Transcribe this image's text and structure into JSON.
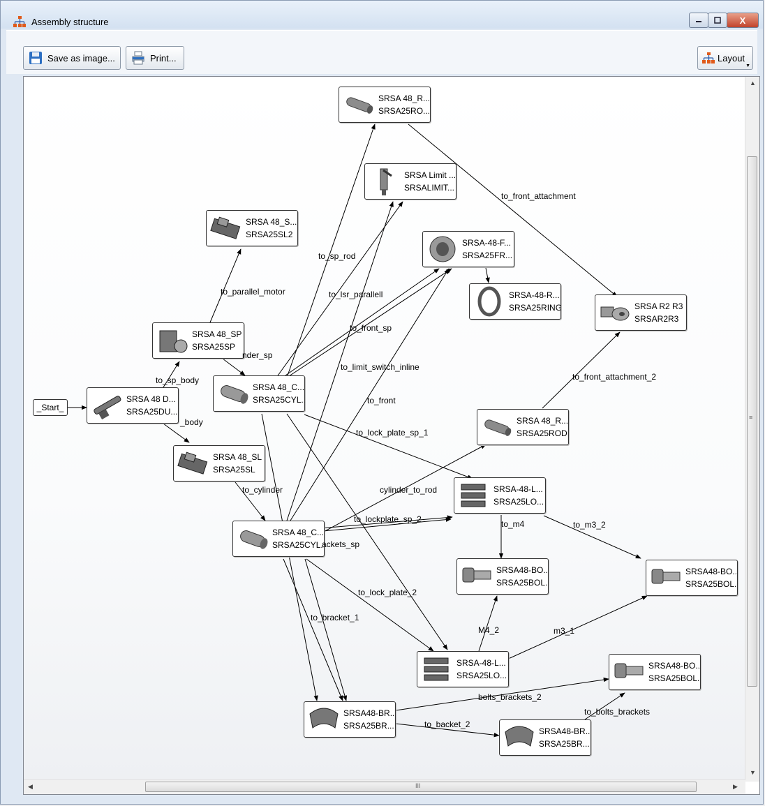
{
  "window": {
    "title": "Assembly structure",
    "close_label": "X"
  },
  "toolbar": {
    "save_label": "Save as image...",
    "print_label": "Print...",
    "layout_label": "Layout"
  },
  "scroll": {
    "h_mid": "III",
    "v_mid": "≡"
  },
  "graph": {
    "start_label": "_Start_",
    "nodes": [
      {
        "id": "rod_top",
        "line1": "SRSA 48_R...",
        "line2": "SRSA25RO...",
        "icon": "rod-icon"
      },
      {
        "id": "limit",
        "line1": "SRSA Limit ...",
        "line2": "SRSALIMIT...",
        "icon": "limit-switch-icon"
      },
      {
        "id": "sl2",
        "line1": "SRSA 48_S...",
        "line2": "SRSA25SL2",
        "icon": "slide-icon"
      },
      {
        "id": "front",
        "line1": "SRSA-48-F...",
        "line2": "SRSA25FR...",
        "icon": "front-flange-icon"
      },
      {
        "id": "ring",
        "line1": "SRSA-48-R...",
        "line2": "SRSA25RING",
        "icon": "ring-icon"
      },
      {
        "id": "r2r3",
        "line1": "SRSA R2 R3",
        "line2": "SRSAR2R3",
        "icon": "attachment-icon"
      },
      {
        "id": "sp",
        "line1": "SRSA 48_SP",
        "line2": "SRSA25SP",
        "icon": "motor-icon"
      },
      {
        "id": "cyl1",
        "line1": "SRSA 48_C...",
        "line2": "SRSA25CYL...",
        "icon": "cylinder-icon"
      },
      {
        "id": "du",
        "line1": "SRSA 48 D...",
        "line2": "SRSA25DU...",
        "icon": "actuator-icon"
      },
      {
        "id": "rod2",
        "line1": "SRSA 48_R...",
        "line2": "SRSA25ROD",
        "icon": "rod-icon"
      },
      {
        "id": "sl",
        "line1": "SRSA 48_SL",
        "line2": "SRSA25SL",
        "icon": "slide-icon"
      },
      {
        "id": "lock1",
        "line1": "SRSA-48-L...",
        "line2": "SRSA25LO...",
        "icon": "lock-plate-icon"
      },
      {
        "id": "cyl2",
        "line1": "SRSA 48_C...",
        "line2": "SRSA25CYL...",
        "icon": "cylinder-icon"
      },
      {
        "id": "bolt1",
        "line1": "SRSA48-BO...",
        "line2": "SRSA25BOL...",
        "icon": "bolt-icon"
      },
      {
        "id": "bolt2",
        "line1": "SRSA48-BO...",
        "line2": "SRSA25BOL...",
        "icon": "bolt-icon"
      },
      {
        "id": "lock2",
        "line1": "SRSA-48-L...",
        "line2": "SRSA25LO...",
        "icon": "lock-plate-icon"
      },
      {
        "id": "bolt3",
        "line1": "SRSA48-BO...",
        "line2": "SRSA25BOL...",
        "icon": "bolt-icon"
      },
      {
        "id": "br1",
        "line1": "SRSA48-BR...",
        "line2": "SRSA25BR...",
        "icon": "bracket-icon"
      },
      {
        "id": "br2",
        "line1": "SRSA48-BR...",
        "line2": "SRSA25BR...",
        "icon": "bracket-icon"
      }
    ],
    "edge_labels": [
      "to_front_attachment",
      "to_sp_rod",
      "to_parallel_motor",
      "to_lsr_parallell",
      "to_front_sp",
      "nder_sp",
      "to_sp_body",
      "to_limit_switch_inline",
      "_body",
      "to_front_attachment_2",
      "to_front",
      "to_lock_plate_sp_1",
      "to_cylinder",
      "cylinder_to_rod",
      "to_lockplate_sp_2",
      "ackets_sp",
      "to_m4",
      "to_m3_2",
      "to_lock_plate_2",
      "to_bracket_1",
      "M4_2",
      "m3_1",
      "bolts_brackets_2",
      "to_bolts_brackets",
      "to_backet_2"
    ]
  }
}
